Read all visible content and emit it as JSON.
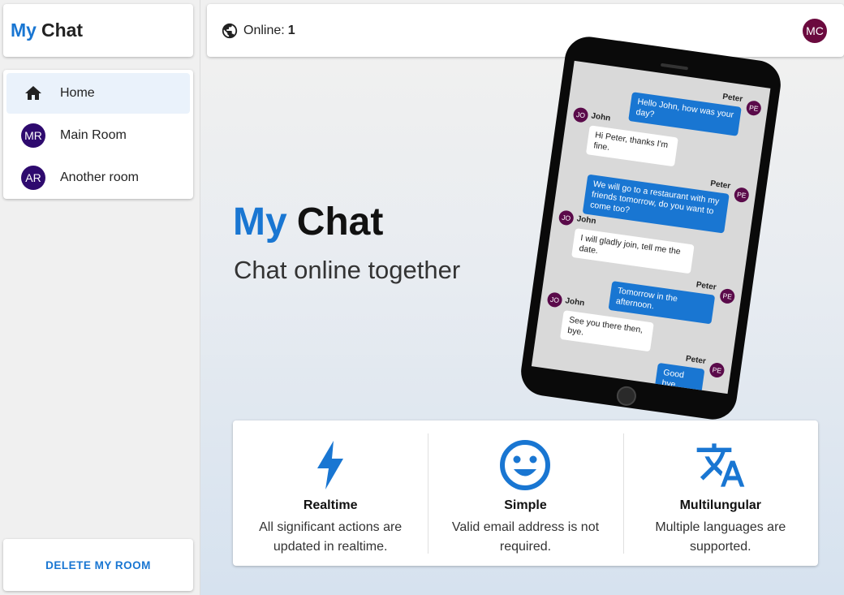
{
  "brand": {
    "word1": "My",
    "word2": "Chat"
  },
  "sidebar": {
    "items": [
      {
        "label": "Home",
        "icon": "home-icon",
        "active": true
      },
      {
        "label": "Main Room",
        "initials": "MR"
      },
      {
        "label": "Another room",
        "initials": "AR"
      }
    ],
    "delete_label": "DELETE MY ROOM"
  },
  "header": {
    "online_label": "Online:",
    "online_count": "1",
    "user_initials": "MC"
  },
  "hero": {
    "title1": "My",
    "title2": "Chat",
    "subtitle": "Chat online together"
  },
  "phone": {
    "messages": [
      {
        "from": "Peter",
        "initials": "PE",
        "text": "Hello John, how was your day?"
      },
      {
        "from": "John",
        "initials": "JO",
        "text": "Hi Peter, thanks I'm fine."
      },
      {
        "from": "Peter",
        "initials": "PE",
        "text": "We will go to a restaurant with my friends tomorrow, do you want to come too?"
      },
      {
        "from": "John",
        "initials": "JO",
        "text": "I will gladly join, tell me the date."
      },
      {
        "from": "Peter",
        "initials": "PE",
        "text": "Tomorrow in the afternoon."
      },
      {
        "from": "John",
        "initials": "JO",
        "text": "See you there then, bye."
      },
      {
        "from": "Peter",
        "initials": "PE",
        "text": "Good bye"
      }
    ]
  },
  "features": [
    {
      "icon": "lightning-icon",
      "title": "Realtime",
      "desc": "All significant actions are updated in realtime."
    },
    {
      "icon": "smiley-icon",
      "title": "Simple",
      "desc": "Valid email address is not required."
    },
    {
      "icon": "translate-icon",
      "title": "Multilungular",
      "desc": "Multiple languages are supported."
    }
  ],
  "colors": {
    "accent": "#1976d2",
    "avatar_room": "#2e0a6e",
    "avatar_user": "#6b0a3e"
  }
}
